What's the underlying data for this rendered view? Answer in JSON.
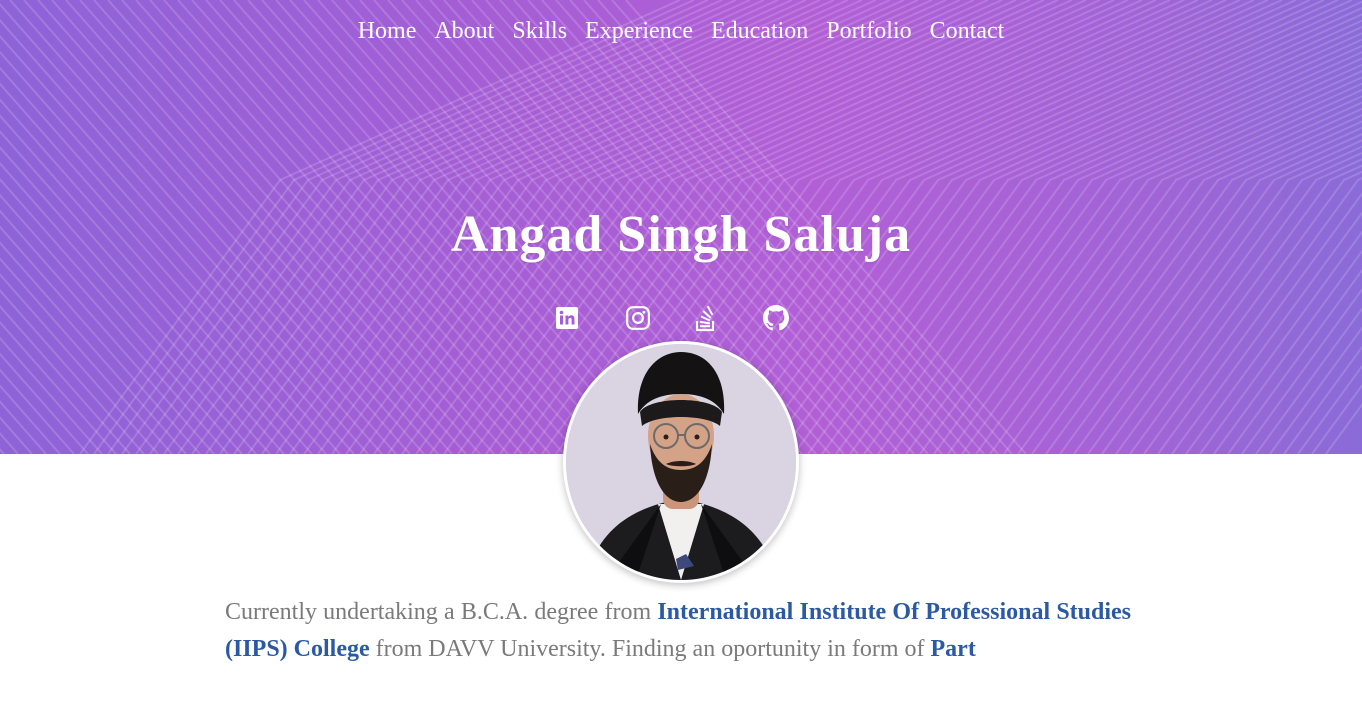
{
  "nav": {
    "items": [
      "Home",
      "About",
      "Skills",
      "Experience",
      "Education",
      "Portfolio",
      "Contact"
    ]
  },
  "hero": {
    "name": "Angad Singh Saluja"
  },
  "social": {
    "icons": [
      "linkedin-icon",
      "instagram-icon",
      "stackoverflow-icon",
      "github-icon"
    ]
  },
  "bio": {
    "t1": "Currently undertaking a B.C.A. degree from ",
    "h1": "International Institute Of Professional Studies (IIPS) College",
    "t2": " from DAVV University. Finding an oportunity in form of ",
    "h2": "Part"
  },
  "colors": {
    "hero_gradient_start": "#8e63d8",
    "hero_gradient_end": "#b25fd6",
    "link_highlight": "#2b5aa3",
    "body_text": "#7a7a7a"
  }
}
